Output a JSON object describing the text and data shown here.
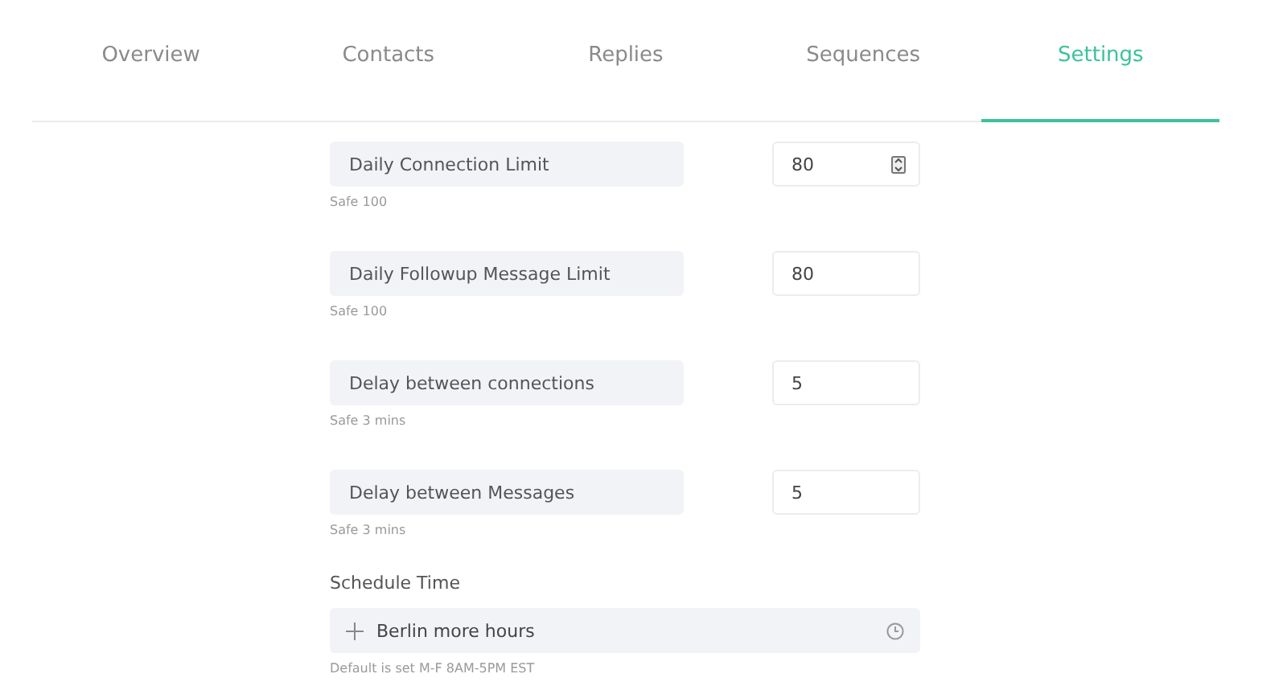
{
  "tabs": [
    {
      "label": "Overview",
      "selected": false
    },
    {
      "label": "Contacts",
      "selected": false
    },
    {
      "label": "Replies",
      "selected": false
    },
    {
      "label": "Sequences",
      "selected": false
    },
    {
      "label": "Settings",
      "selected": true
    }
  ],
  "limits": [
    {
      "label": "Daily Connection Limit",
      "value": "80",
      "hint": "Safe 100",
      "spinner": true
    },
    {
      "label": "Daily Followup Message Limit",
      "value": "80",
      "hint": "Safe 100",
      "spinner": false
    },
    {
      "label": "Delay between connections",
      "value": "5",
      "hint": "Safe 3 mins",
      "spinner": false
    },
    {
      "label": "Delay between Messages",
      "value": "5",
      "hint": "Safe 3 mins",
      "spinner": false
    }
  ],
  "schedule": {
    "title": "Schedule Time",
    "value": "Berlin more hours",
    "hint": "Default is set M-F 8AM-5PM EST"
  }
}
